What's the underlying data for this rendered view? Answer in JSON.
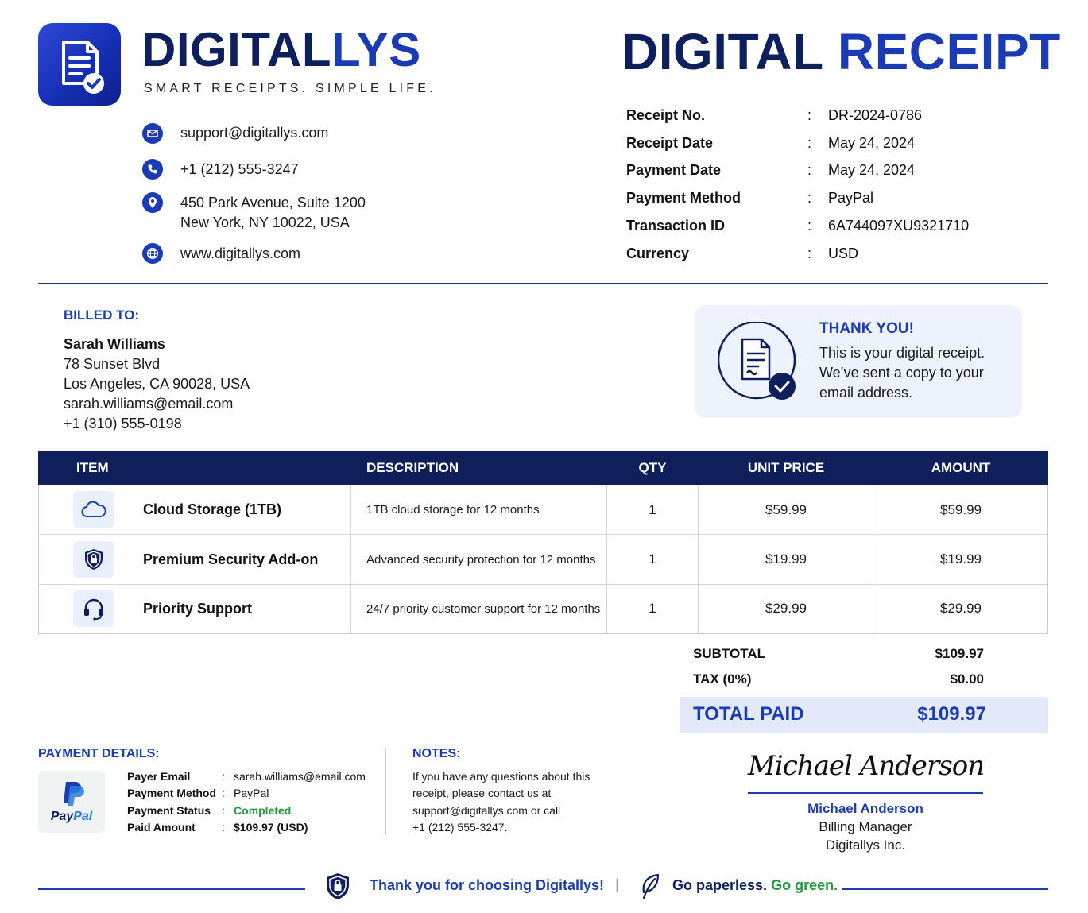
{
  "brand": {
    "name_part1": "DIGITAL",
    "name_part2": "LYS",
    "tagline": "SMART RECEIPTS. SIMPLE LIFE.",
    "logo_icon": "receipt-check-icon"
  },
  "contact": {
    "email": "support@digitallys.com",
    "phone": "+1 (212) 555-3247",
    "address_line1": "450 Park Avenue, Suite 1200",
    "address_line2": "New York, NY 10022, USA",
    "website": "www.digitallys.com"
  },
  "title": {
    "part1": "DIGITAL",
    "part2": "RECEIPT"
  },
  "meta": [
    {
      "label": "Receipt No.",
      "value": "DR-2024-0786"
    },
    {
      "label": "Receipt Date",
      "value": "May 24, 2024"
    },
    {
      "label": "Payment Date",
      "value": "May 24, 2024"
    },
    {
      "label": "Payment Method",
      "value": "PayPal"
    },
    {
      "label": "Transaction ID",
      "value": "6A744097XU9321710"
    },
    {
      "label": "Currency",
      "value": "USD"
    }
  ],
  "meta_separator": ":",
  "billed_to": {
    "heading": "BILLED TO:",
    "name": "Sarah Williams",
    "street": "78 Sunset Blvd",
    "city": "Los Angeles, CA 90028, USA",
    "email": "sarah.williams@email.com",
    "phone": "+1 (310) 555-0198"
  },
  "thank_you": {
    "title": "THANK YOU!",
    "line1": "This is your digital receipt.",
    "line2": "We’ve sent a copy to your",
    "line3": "email address."
  },
  "table": {
    "headers": [
      "ITEM",
      "DESCRIPTION",
      "QTY",
      "UNIT PRICE",
      "AMOUNT"
    ],
    "rows": [
      {
        "icon": "cloud-icon",
        "name": "Cloud Storage (1TB)",
        "description": "1TB cloud storage for 12 months",
        "qty": "1",
        "unit_price": "$59.99",
        "amount": "$59.99"
      },
      {
        "icon": "shield-lock-icon",
        "name": "Premium Security Add-on",
        "description": "Advanced security protection for 12 months",
        "qty": "1",
        "unit_price": "$19.99",
        "amount": "$19.99"
      },
      {
        "icon": "headset-icon",
        "name": "Priority Support",
        "description": "24/7 priority customer support for 12 months",
        "qty": "1",
        "unit_price": "$29.99",
        "amount": "$29.99"
      }
    ]
  },
  "totals": {
    "subtotal_label": "SUBTOTAL",
    "subtotal": "$109.97",
    "tax_label": "TAX (0%)",
    "tax": "$0.00",
    "total_label": "TOTAL PAID",
    "total": "$109.97"
  },
  "payment_details": {
    "heading": "PAYMENT DETAILS:",
    "logo_text_1": "Pay",
    "logo_text_2": "Pal",
    "rows": [
      {
        "label": "Payer Email",
        "value": "sarah.williams@email.com"
      },
      {
        "label": "Payment Method",
        "value": "PayPal"
      },
      {
        "label": "Payment Status",
        "value": "Completed"
      },
      {
        "label": "Paid Amount",
        "value": "$109.97 (USD)"
      }
    ]
  },
  "notes": {
    "heading": "NOTES:",
    "lines": [
      "If you have any questions about this",
      "receipt, please contact us at",
      "support@digitallys.com or call",
      "+1 (212) 555-3247."
    ]
  },
  "signature": {
    "script": "Michael Anderson",
    "name": "Michael Anderson",
    "role": "Billing Manager",
    "company": "Digitallys Inc."
  },
  "footer": {
    "thanks": "Thank you for choosing Digitallys!",
    "divider": "|",
    "paperless": "Go paperless.",
    "green": "Go green."
  },
  "colors": {
    "navy": "#0d1f5c",
    "brand_blue": "#1a3bb3",
    "success_green": "#1e9e3a"
  }
}
